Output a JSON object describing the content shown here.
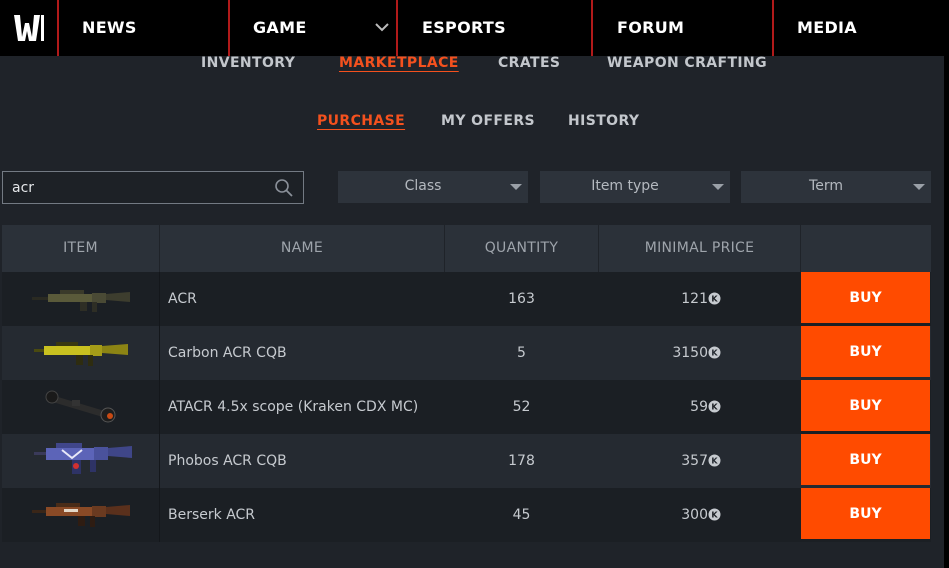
{
  "topnav": {
    "items": [
      "NEWS",
      "GAME",
      "ESPORTS",
      "FORUM",
      "MEDIA"
    ]
  },
  "subnav": {
    "items": [
      "INVENTORY",
      "MARKETPLACE",
      "CRATES",
      "WEAPON CRAFTING"
    ],
    "active": "MARKETPLACE"
  },
  "tabs": {
    "items": [
      "PURCHASE",
      "MY OFFERS",
      "HISTORY"
    ],
    "active": "PURCHASE"
  },
  "search": {
    "value": "acr"
  },
  "filters": [
    "Class",
    "Item type",
    "Term"
  ],
  "table": {
    "headers": [
      "ITEM",
      "NAME",
      "QUANTITY",
      "MINIMAL PRICE"
    ],
    "buy_label": "BUY",
    "rows": [
      {
        "name": "ACR",
        "quantity": "163",
        "price": "121",
        "icon": "acr-rifle-icon"
      },
      {
        "name": "Carbon ACR CQB",
        "quantity": "5",
        "price": "3150",
        "icon": "carbon-acr-cqb-icon"
      },
      {
        "name": "ATACR 4.5x scope (Kraken CDX MC)",
        "quantity": "52",
        "price": "59",
        "icon": "scope-icon"
      },
      {
        "name": "Phobos ACR CQB",
        "quantity": "178",
        "price": "357",
        "icon": "phobos-acr-cqb-icon"
      },
      {
        "name": "Berserk ACR",
        "quantity": "45",
        "price": "300",
        "icon": "berserk-acr-icon"
      }
    ]
  },
  "colors": {
    "accent": "#ff4b00",
    "active_link": "#f4511e",
    "nav_separator": "#b11a1a"
  }
}
